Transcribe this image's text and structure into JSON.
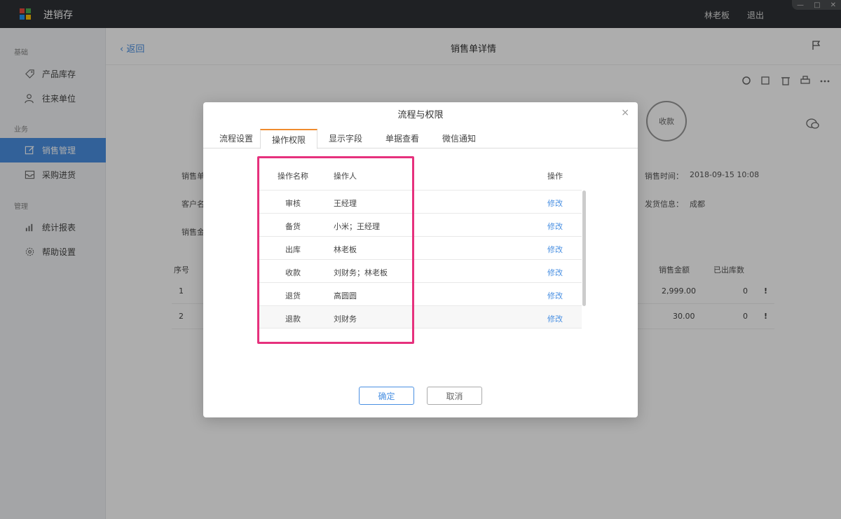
{
  "app": {
    "title": "进销存"
  },
  "topbar": {
    "user": "林老板",
    "logout": "退出",
    "window_controls": [
      "—",
      "□",
      "✕"
    ]
  },
  "sidebar": {
    "sections": [
      {
        "label": "基础",
        "items": [
          {
            "label": "产品库存",
            "icon": "tag-icon"
          },
          {
            "label": "往来单位",
            "icon": "contacts-icon"
          }
        ]
      },
      {
        "label": "业务",
        "items": [
          {
            "label": "销售管理",
            "icon": "edit-icon",
            "active": true
          },
          {
            "label": "采购进货",
            "icon": "inbox-icon"
          }
        ]
      },
      {
        "label": "管理",
        "items": [
          {
            "label": "统计报表",
            "icon": "chart-icon"
          },
          {
            "label": "帮助设置",
            "icon": "gear-icon"
          }
        ]
      }
    ]
  },
  "header": {
    "back": "返回",
    "title": "销售单详情"
  },
  "detail": {
    "stamp": "收款",
    "fields": [
      {
        "label": "销售单"
      },
      {
        "label": "客户名"
      },
      {
        "label": "销售金"
      }
    ],
    "sale_time_label": "销售时间：",
    "sale_time": "2018-09-15 10:08",
    "delivery_label": "发货信息：",
    "delivery": "成都",
    "columns": {
      "seq": "序号",
      "amount": "销售金额",
      "shipped": "已出库数"
    },
    "rows": [
      {
        "seq": "1",
        "amount": "2,999.00",
        "shipped": "0",
        "warn": "!"
      },
      {
        "seq": "2",
        "amount": "30.00",
        "shipped": "0",
        "warn": "!"
      }
    ]
  },
  "modal": {
    "title": "流程与权限",
    "close": "×",
    "tabs": [
      "流程设置",
      "操作权限",
      "显示字段",
      "单据查看",
      "微信通知"
    ],
    "active_tab": 1,
    "columns": {
      "name": "操作名称",
      "person": "操作人",
      "op": "操作"
    },
    "rows": [
      {
        "name": "审核",
        "person": "王经理",
        "op": "修改"
      },
      {
        "name": "备货",
        "person": "小米；王经理",
        "op": "修改"
      },
      {
        "name": "出库",
        "person": "林老板",
        "op": "修改"
      },
      {
        "name": "收款",
        "person": "刘财务；林老板",
        "op": "修改"
      },
      {
        "name": "退货",
        "person": "高圆圆",
        "op": "修改"
      },
      {
        "name": "退款",
        "person": "刘财务",
        "op": "修改"
      }
    ],
    "ok": "确定",
    "cancel": "取消"
  },
  "colors": {
    "accent": "#4a90e2",
    "highlight": "#e6317d",
    "tab_active": "#f08c2e"
  }
}
